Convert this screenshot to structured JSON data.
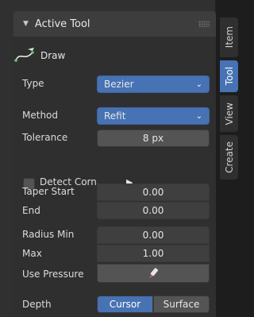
{
  "panel": {
    "title": "Active Tool",
    "tool_name": "Draw"
  },
  "properties": {
    "type_label": "Type",
    "type_value": "Bezier",
    "method_label": "Method",
    "method_value": "Refit",
    "tolerance_label": "Tolerance",
    "tolerance_value": "8 px",
    "detect_corners_label": "Detect Corn...",
    "taper_start_label": "Taper Start",
    "taper_start_value": "0.00",
    "end_label": "End",
    "end_value": "0.00",
    "radius_min_label": "Radius Min",
    "radius_min_value": "0.00",
    "max_label": "Max",
    "max_value": "1.00",
    "use_pressure_label": "Use Pressure",
    "depth_label": "Depth",
    "depth_options": [
      "Cursor",
      "Surface"
    ]
  },
  "tabs": [
    "Item",
    "Tool",
    "View",
    "Create"
  ],
  "colors": {
    "accent": "#4772b3",
    "panel_bg": "#303030",
    "field_bg": "#545454"
  }
}
